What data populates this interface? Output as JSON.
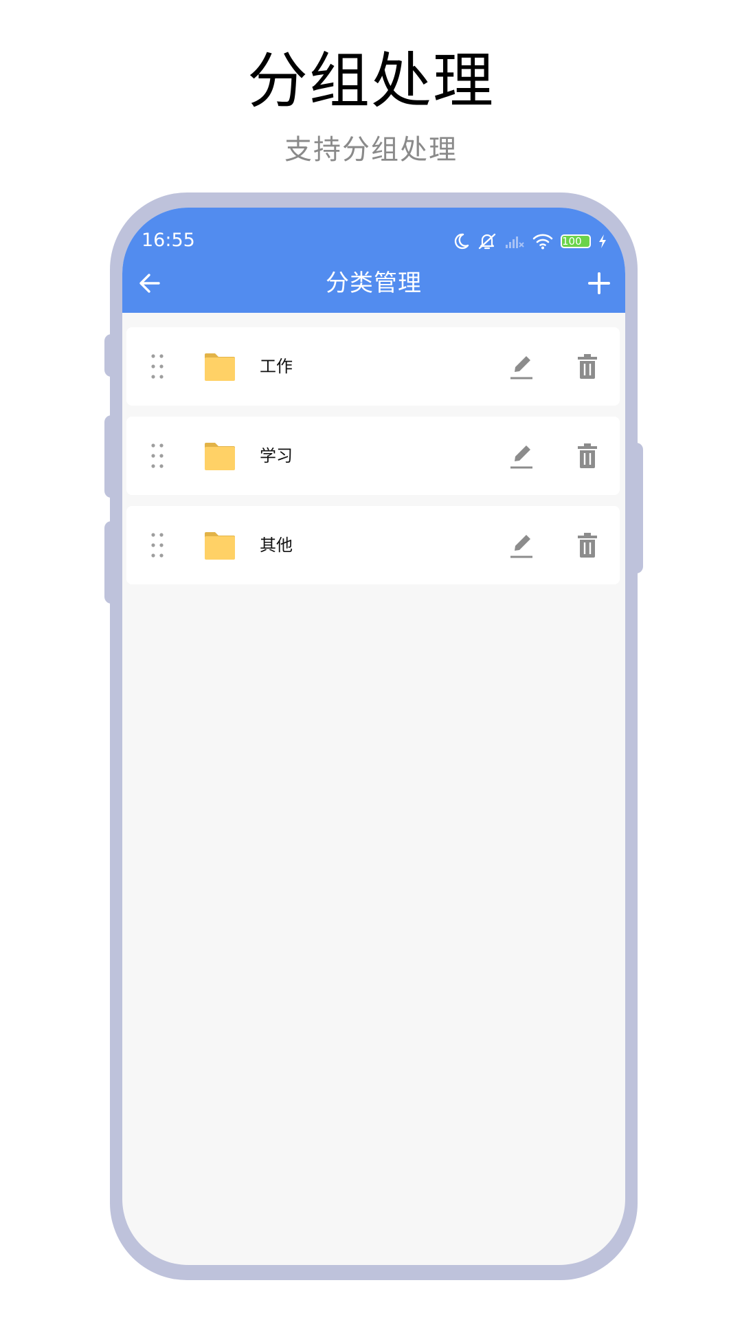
{
  "promo": {
    "title": "分组处理",
    "subtitle": "支持分组处理"
  },
  "status_bar": {
    "time": "16:55",
    "battery_level": "100",
    "icons": [
      "moon-icon",
      "mute-icon",
      "signal-icon",
      "wifi-icon",
      "battery-icon",
      "charging-icon"
    ]
  },
  "appbar": {
    "title": "分类管理",
    "back_icon": "arrow-left-icon",
    "add_icon": "plus-icon"
  },
  "categories": [
    {
      "label": "工作"
    },
    {
      "label": "学习"
    },
    {
      "label": "其他"
    }
  ],
  "colors": {
    "accent": "#528cef",
    "frame": "#bec2db",
    "folder": "#ffd166",
    "action_icon": "#8c8c8c"
  }
}
